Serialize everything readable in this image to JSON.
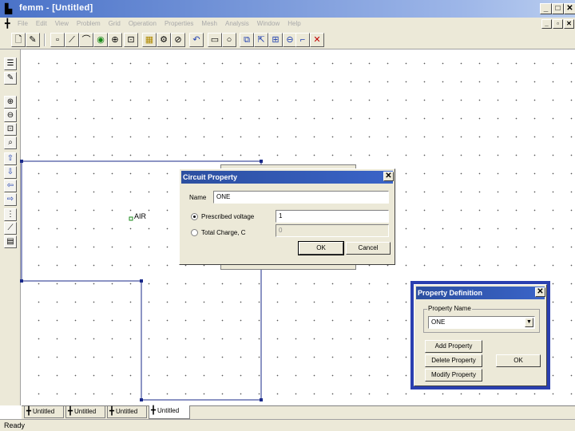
{
  "window": {
    "title": "femm - [Untitled]",
    "minimize_glyph": "_",
    "maximize_glyph": "□",
    "close_glyph": "✕"
  },
  "menubar": {
    "items": [
      "File",
      "Edit",
      "View",
      "Problem",
      "Grid",
      "Operation",
      "Properties",
      "Mesh",
      "Analysis",
      "Window",
      "Help"
    ]
  },
  "canvas": {
    "block_label": "AIR"
  },
  "circuit_dialog": {
    "title": "Circuit Property",
    "name_label": "Name",
    "name_value": "ONE",
    "voltage_label": "Prescribed voltage",
    "voltage_value": "1",
    "charge_label": "Total Charge, C",
    "charge_value": "0",
    "ok_label": "OK",
    "cancel_label": "Cancel"
  },
  "property_dialog": {
    "title": "Property Definition",
    "group_label": "Property Name",
    "selected": "ONE",
    "add_label": "Add Property",
    "delete_label": "Delete Property",
    "modify_label": "Modify Property",
    "ok_label": "OK"
  },
  "tabs": [
    "Untitled",
    "Untitled",
    "Untitled",
    "Untitled"
  ],
  "status": "Ready",
  "colors": {
    "title_gradient_start": "#4a72c8",
    "dialog_title": "#2c4fa0",
    "geometry_line": "#1a2a8a",
    "property_dialog_border": "#2a3fb0"
  }
}
